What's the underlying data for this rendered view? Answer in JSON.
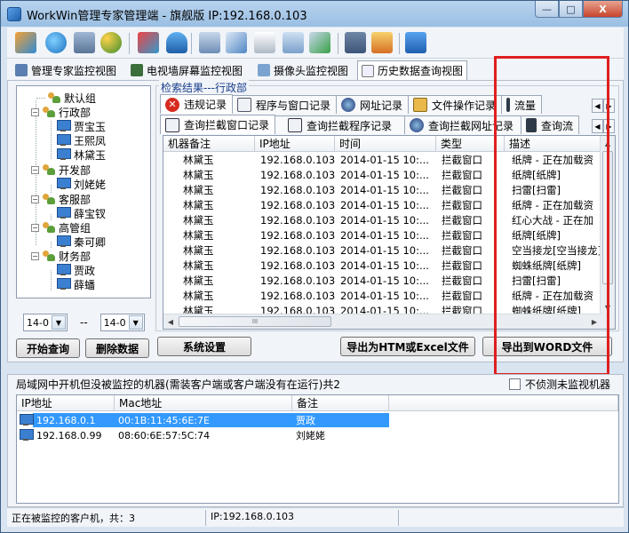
{
  "window": {
    "title": "WorkWin管理专家管理端 - 旗舰版 IP:192.168.0.103",
    "min_glyph": "—",
    "max_glyph": "□",
    "close_glyph": "X"
  },
  "view_tabs": [
    {
      "label": "管理专家监控视图"
    },
    {
      "label": "电视墙屏幕监控视图"
    },
    {
      "label": "摄像头监控视图"
    },
    {
      "label": "历史数据查询视图"
    }
  ],
  "tree": {
    "nodes": [
      {
        "label": "默认组",
        "type": "group"
      },
      {
        "label": "行政部",
        "type": "group",
        "toggle": "−"
      },
      {
        "label": "贾宝玉",
        "type": "pc"
      },
      {
        "label": "王熙凤",
        "type": "pc"
      },
      {
        "label": "林黛玉",
        "type": "pc"
      },
      {
        "label": "开发部",
        "type": "group",
        "toggle": "−"
      },
      {
        "label": "刘姥姥",
        "type": "pc"
      },
      {
        "label": "客服部",
        "type": "group",
        "toggle": "−"
      },
      {
        "label": "薛宝钗",
        "type": "pc"
      },
      {
        "label": "高管组",
        "type": "group",
        "toggle": "−"
      },
      {
        "label": "秦可卿",
        "type": "pc"
      },
      {
        "label": "财务部",
        "type": "group",
        "toggle": "−"
      },
      {
        "label": "贾政",
        "type": "pc"
      },
      {
        "label": "薛蟠",
        "type": "pc"
      }
    ]
  },
  "date_range": {
    "from": "14-0",
    "separator": "--",
    "to": "14-0",
    "dropdown_glyph": "▼"
  },
  "buttons": {
    "start_query": "开始查询",
    "delete_data": "删除数据",
    "system_settings": "系统设置",
    "export_html": "导出为HTM或Excel文件",
    "export_word": "导出到WORD文件"
  },
  "search_result_label": "检索结果---行政部",
  "record_tabs": [
    {
      "label": "违规记录",
      "active": true
    },
    {
      "label": "程序与窗口记录"
    },
    {
      "label": "网址记录"
    },
    {
      "label": "文件操作记录"
    },
    {
      "label": "流量"
    }
  ],
  "query_tabs": [
    {
      "label": "查询拦截窗口记录",
      "active": true
    },
    {
      "label": "查询拦截程序记录"
    },
    {
      "label": "查询拦截网址记录"
    },
    {
      "label": "查询流"
    }
  ],
  "spinner": {
    "left": "◀",
    "right": "▶"
  },
  "grid": {
    "columns": [
      "机器备注",
      "IP地址",
      "时间",
      "类型",
      "描述"
    ],
    "rows": [
      [
        "林黛玉",
        "192.168.0.103",
        "2014-01-15 10:...",
        "拦截窗口",
        "纸牌 - 正在加载资"
      ],
      [
        "林黛玉",
        "192.168.0.103",
        "2014-01-15 10:...",
        "拦截窗口",
        "纸牌[纸牌]"
      ],
      [
        "林黛玉",
        "192.168.0.103",
        "2014-01-15 10:...",
        "拦截窗口",
        "扫雷[扫雷]"
      ],
      [
        "林黛玉",
        "192.168.0.103",
        "2014-01-15 10:...",
        "拦截窗口",
        "纸牌 - 正在加载资"
      ],
      [
        "林黛玉",
        "192.168.0.103",
        "2014-01-15 10:...",
        "拦截窗口",
        "红心大战 - 正在加"
      ],
      [
        "林黛玉",
        "192.168.0.103",
        "2014-01-15 10:...",
        "拦截窗口",
        "纸牌[纸牌]"
      ],
      [
        "林黛玉",
        "192.168.0.103",
        "2014-01-15 10:...",
        "拦截窗口",
        "空当接龙[空当接龙]"
      ],
      [
        "林黛玉",
        "192.168.0.103",
        "2014-01-15 10:...",
        "拦截窗口",
        "蜘蛛纸牌[纸牌]"
      ],
      [
        "林黛玉",
        "192.168.0.103",
        "2014-01-15 10:...",
        "拦截窗口",
        "扫雷[扫雷]"
      ],
      [
        "林黛玉",
        "192.168.0.103",
        "2014-01-15 10:...",
        "拦截窗口",
        "纸牌 - 正在加载资"
      ],
      [
        "林黛玉",
        "192.168.0.103",
        "2014-01-15 10:...",
        "拦截窗口",
        "蜘蛛纸牌[纸牌]"
      ]
    ],
    "scroll_up": "▲",
    "scroll_down": "▼",
    "scroll_left": "◀",
    "scroll_right": "▶",
    "thumb_grip": "III"
  },
  "lower": {
    "title": "局域网中开机但没被监控的机器(需装客户端或客户端没有在运行)共2",
    "ignore_checkbox_label": "不侦测未监视机器",
    "columns": [
      "IP地址",
      "Mac地址",
      "备注"
    ],
    "rows": [
      [
        "192.168.0.1",
        "00:1B:11:45:6E:7E",
        "贾政"
      ],
      [
        "192.168.0.99",
        "08:60:6E:57:5C:74",
        "刘姥姥"
      ]
    ]
  },
  "status": {
    "monitored": "正在被监控的客户机，共：3",
    "ip": "IP:192.168.0.103"
  },
  "colors": {
    "highlight_box": "#e01f1f",
    "selection": "#3399ff"
  }
}
